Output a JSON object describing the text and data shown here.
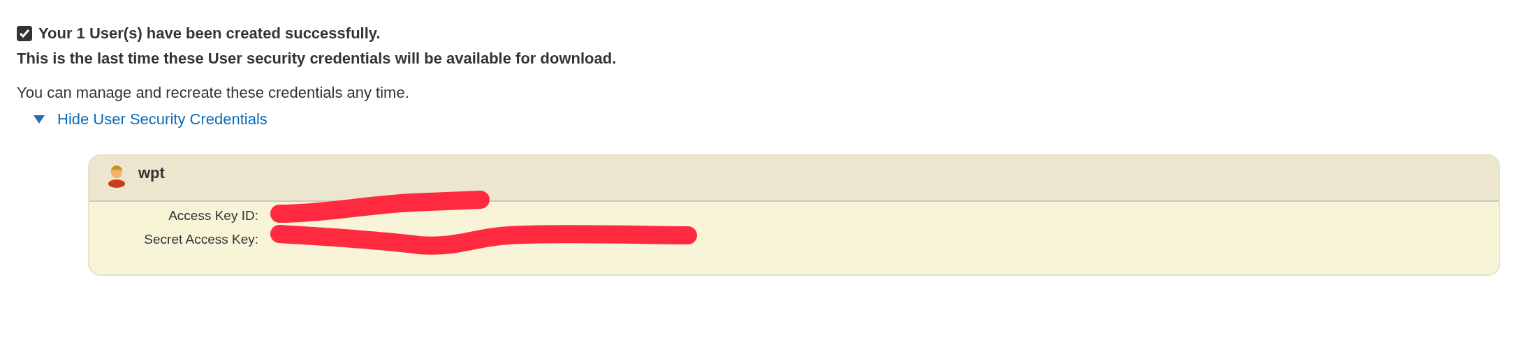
{
  "notice": {
    "title": "Your 1 User(s) have been created successfully.",
    "warning": "This is the last time these User security credentials will be available for download.",
    "info": "You can manage and recreate these credentials any time."
  },
  "toggle": {
    "label": "Hide User Security Credentials",
    "expanded": true
  },
  "user_card": {
    "name": "wpt",
    "fields": [
      {
        "label": "Access Key ID:"
      },
      {
        "label": "Secret Access Key:"
      }
    ]
  }
}
